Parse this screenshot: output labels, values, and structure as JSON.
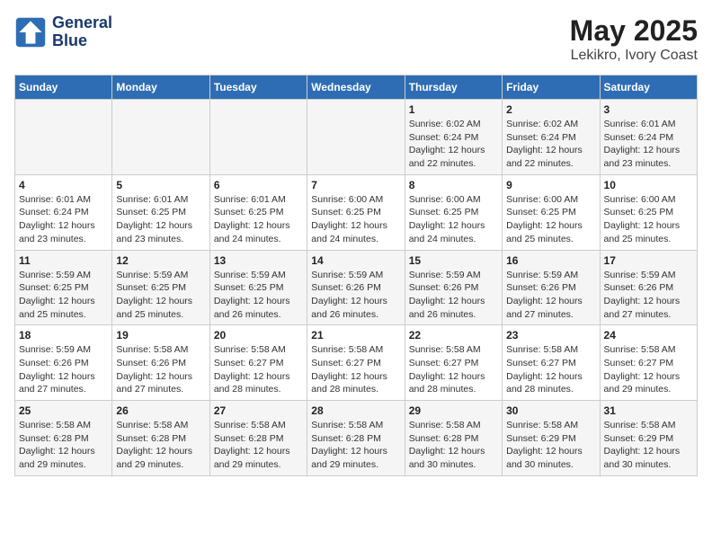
{
  "header": {
    "logo_line1": "General",
    "logo_line2": "Blue",
    "title": "May 2025",
    "subtitle": "Lekikro, Ivory Coast"
  },
  "weekdays": [
    "Sunday",
    "Monday",
    "Tuesday",
    "Wednesday",
    "Thursday",
    "Friday",
    "Saturday"
  ],
  "weeks": [
    [
      {
        "day": "",
        "info": ""
      },
      {
        "day": "",
        "info": ""
      },
      {
        "day": "",
        "info": ""
      },
      {
        "day": "",
        "info": ""
      },
      {
        "day": "1",
        "info": "Sunrise: 6:02 AM\nSunset: 6:24 PM\nDaylight: 12 hours and 22 minutes."
      },
      {
        "day": "2",
        "info": "Sunrise: 6:02 AM\nSunset: 6:24 PM\nDaylight: 12 hours and 22 minutes."
      },
      {
        "day": "3",
        "info": "Sunrise: 6:01 AM\nSunset: 6:24 PM\nDaylight: 12 hours and 23 minutes."
      }
    ],
    [
      {
        "day": "4",
        "info": "Sunrise: 6:01 AM\nSunset: 6:24 PM\nDaylight: 12 hours and 23 minutes."
      },
      {
        "day": "5",
        "info": "Sunrise: 6:01 AM\nSunset: 6:25 PM\nDaylight: 12 hours and 23 minutes."
      },
      {
        "day": "6",
        "info": "Sunrise: 6:01 AM\nSunset: 6:25 PM\nDaylight: 12 hours and 24 minutes."
      },
      {
        "day": "7",
        "info": "Sunrise: 6:00 AM\nSunset: 6:25 PM\nDaylight: 12 hours and 24 minutes."
      },
      {
        "day": "8",
        "info": "Sunrise: 6:00 AM\nSunset: 6:25 PM\nDaylight: 12 hours and 24 minutes."
      },
      {
        "day": "9",
        "info": "Sunrise: 6:00 AM\nSunset: 6:25 PM\nDaylight: 12 hours and 25 minutes."
      },
      {
        "day": "10",
        "info": "Sunrise: 6:00 AM\nSunset: 6:25 PM\nDaylight: 12 hours and 25 minutes."
      }
    ],
    [
      {
        "day": "11",
        "info": "Sunrise: 5:59 AM\nSunset: 6:25 PM\nDaylight: 12 hours and 25 minutes."
      },
      {
        "day": "12",
        "info": "Sunrise: 5:59 AM\nSunset: 6:25 PM\nDaylight: 12 hours and 25 minutes."
      },
      {
        "day": "13",
        "info": "Sunrise: 5:59 AM\nSunset: 6:25 PM\nDaylight: 12 hours and 26 minutes."
      },
      {
        "day": "14",
        "info": "Sunrise: 5:59 AM\nSunset: 6:26 PM\nDaylight: 12 hours and 26 minutes."
      },
      {
        "day": "15",
        "info": "Sunrise: 5:59 AM\nSunset: 6:26 PM\nDaylight: 12 hours and 26 minutes."
      },
      {
        "day": "16",
        "info": "Sunrise: 5:59 AM\nSunset: 6:26 PM\nDaylight: 12 hours and 27 minutes."
      },
      {
        "day": "17",
        "info": "Sunrise: 5:59 AM\nSunset: 6:26 PM\nDaylight: 12 hours and 27 minutes."
      }
    ],
    [
      {
        "day": "18",
        "info": "Sunrise: 5:59 AM\nSunset: 6:26 PM\nDaylight: 12 hours and 27 minutes."
      },
      {
        "day": "19",
        "info": "Sunrise: 5:58 AM\nSunset: 6:26 PM\nDaylight: 12 hours and 27 minutes."
      },
      {
        "day": "20",
        "info": "Sunrise: 5:58 AM\nSunset: 6:27 PM\nDaylight: 12 hours and 28 minutes."
      },
      {
        "day": "21",
        "info": "Sunrise: 5:58 AM\nSunset: 6:27 PM\nDaylight: 12 hours and 28 minutes."
      },
      {
        "day": "22",
        "info": "Sunrise: 5:58 AM\nSunset: 6:27 PM\nDaylight: 12 hours and 28 minutes."
      },
      {
        "day": "23",
        "info": "Sunrise: 5:58 AM\nSunset: 6:27 PM\nDaylight: 12 hours and 28 minutes."
      },
      {
        "day": "24",
        "info": "Sunrise: 5:58 AM\nSunset: 6:27 PM\nDaylight: 12 hours and 29 minutes."
      }
    ],
    [
      {
        "day": "25",
        "info": "Sunrise: 5:58 AM\nSunset: 6:28 PM\nDaylight: 12 hours and 29 minutes."
      },
      {
        "day": "26",
        "info": "Sunrise: 5:58 AM\nSunset: 6:28 PM\nDaylight: 12 hours and 29 minutes."
      },
      {
        "day": "27",
        "info": "Sunrise: 5:58 AM\nSunset: 6:28 PM\nDaylight: 12 hours and 29 minutes."
      },
      {
        "day": "28",
        "info": "Sunrise: 5:58 AM\nSunset: 6:28 PM\nDaylight: 12 hours and 29 minutes."
      },
      {
        "day": "29",
        "info": "Sunrise: 5:58 AM\nSunset: 6:28 PM\nDaylight: 12 hours and 30 minutes."
      },
      {
        "day": "30",
        "info": "Sunrise: 5:58 AM\nSunset: 6:29 PM\nDaylight: 12 hours and 30 minutes."
      },
      {
        "day": "31",
        "info": "Sunrise: 5:58 AM\nSunset: 6:29 PM\nDaylight: 12 hours and 30 minutes."
      }
    ]
  ]
}
